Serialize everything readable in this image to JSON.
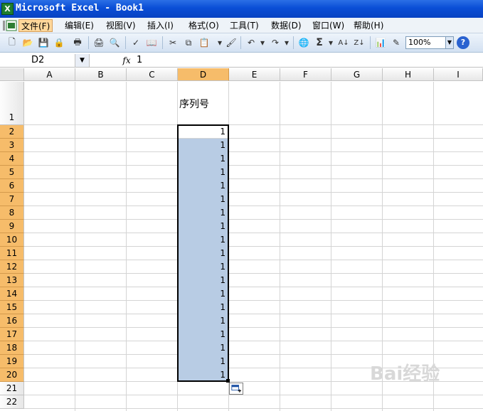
{
  "window": {
    "title": "Microsoft Excel - Book1"
  },
  "menu": {
    "items": [
      "文件(F)",
      "编辑(E)",
      "视图(V)",
      "插入(I)",
      "格式(O)",
      "工具(T)",
      "数据(D)",
      "窗口(W)",
      "帮助(H)"
    ]
  },
  "toolbar": {
    "zoom": "100%",
    "icons": [
      "new-icon",
      "open-icon",
      "save-icon",
      "permission-icon",
      "print-icon",
      "print-preview-icon",
      "spelling-icon",
      "research-icon",
      "cut-icon",
      "copy-icon",
      "paste-icon",
      "format-painter-icon",
      "undo-icon",
      "redo-icon",
      "hyperlink-icon",
      "autosum-icon",
      "sort-ascending-icon",
      "sort-descending-icon",
      "chart-wizard-icon",
      "drawing-icon",
      "help-icon"
    ]
  },
  "formula_bar": {
    "name_box": "D2",
    "fx": "fx",
    "value": "1"
  },
  "sheet": {
    "columns": [
      "A",
      "B",
      "C",
      "D",
      "E",
      "F",
      "G",
      "H",
      "I"
    ],
    "selected_column": "D",
    "rows": [
      "1",
      "2",
      "3",
      "4",
      "5",
      "6",
      "7",
      "8",
      "9",
      "10",
      "11",
      "12",
      "13",
      "14",
      "15",
      "16",
      "17",
      "18",
      "19",
      "20",
      "21",
      "22"
    ],
    "selected_rows": [
      "2",
      "3",
      "4",
      "5",
      "6",
      "7",
      "8",
      "9",
      "10",
      "11",
      "12",
      "13",
      "14",
      "15",
      "16",
      "17",
      "18",
      "19",
      "20"
    ],
    "d1_header": "序列号",
    "d_values": [
      "1",
      "1",
      "1",
      "1",
      "1",
      "1",
      "1",
      "1",
      "1",
      "1",
      "1",
      "1",
      "1",
      "1",
      "1",
      "1",
      "1",
      "1",
      "1"
    ]
  },
  "colors": {
    "selection_fill": "#b8cce4",
    "header_selected": "#f6bc6a",
    "titlebar": "#0a4ed6"
  },
  "watermark": "Bai经验"
}
